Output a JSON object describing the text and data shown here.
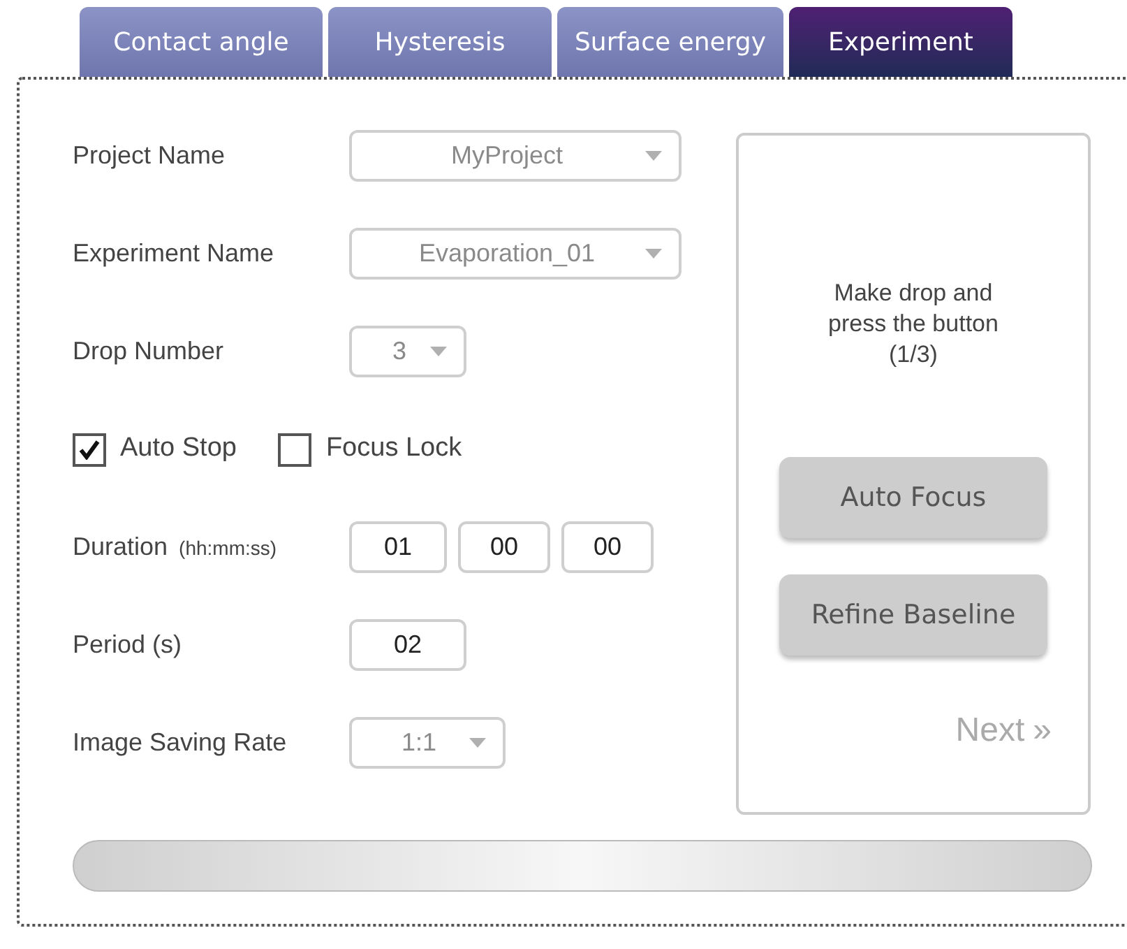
{
  "tabs": [
    {
      "label": "Contact angle",
      "selected": false
    },
    {
      "label": "Hysteresis",
      "selected": false
    },
    {
      "label": "Surface energy",
      "selected": false
    },
    {
      "label": "Experiment",
      "selected": true
    }
  ],
  "form": {
    "project_name": {
      "label": "Project Name",
      "value": "MyProject"
    },
    "experiment_name": {
      "label": "Experiment Name",
      "value": "Evaporation_01"
    },
    "drop_number": {
      "label": "Drop Number",
      "value": "3"
    },
    "checkboxes": [
      {
        "label": "Auto Stop",
        "checked": true
      },
      {
        "label": "Focus Lock",
        "checked": false
      }
    ],
    "duration": {
      "label": "Duration",
      "hint": "(hh:mm:ss)",
      "values": [
        "01",
        "00",
        "00"
      ]
    },
    "period": {
      "label": "Period (s)",
      "value": "02"
    },
    "image_saving_rate": {
      "label": "Image Saving Rate",
      "value": "1:1"
    }
  },
  "instructions": {
    "message": "Make drop and press the button (1/3)",
    "buttons": [
      "Auto Focus",
      "Refine Baseline"
    ],
    "next": {
      "label": "Next",
      "icon": "»",
      "disabled": true
    }
  },
  "progress": {
    "level": 0
  }
}
